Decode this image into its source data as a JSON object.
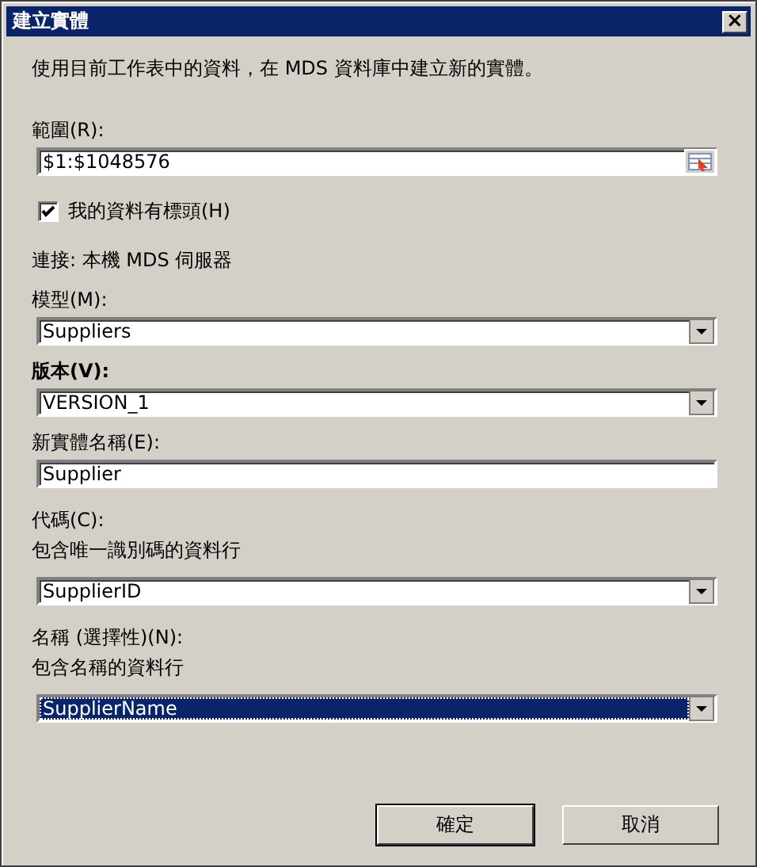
{
  "window": {
    "title": "建立實體",
    "close": "×"
  },
  "intro": "使用目前工作表中的資料，在 MDS 資料庫中建立新的實體。",
  "range": {
    "label": "範圍(R):",
    "value": "$1:$1048576"
  },
  "header_checkbox": {
    "label": "我的資料有標頭(H)",
    "checked": true
  },
  "connection": "連接: 本機 MDS 伺服器",
  "fields": [
    {
      "kind": "dropdown",
      "label": "模型(M):",
      "bold": false,
      "value": "Suppliers",
      "focused": false
    },
    {
      "kind": "dropdown",
      "label": "版本(V):",
      "bold": true,
      "value": "VERSION_1",
      "focused": false
    },
    {
      "kind": "text",
      "label": "新實體名稱(E):",
      "bold": false,
      "value": "Supplier",
      "focused": false
    },
    {
      "kind": "dropdown",
      "label": "代碼(C):",
      "hint": "包含唯一識別碼的資料行",
      "bold": false,
      "value": "SupplierID",
      "focused": false
    },
    {
      "kind": "dropdown",
      "label": "名稱 (選擇性)(N):",
      "hint": "包含名稱的資料行",
      "bold": false,
      "value": "SupplierName",
      "focused": true
    }
  ],
  "buttons": [
    {
      "label": "確定",
      "default": true
    },
    {
      "label": "取消",
      "default": false
    }
  ]
}
